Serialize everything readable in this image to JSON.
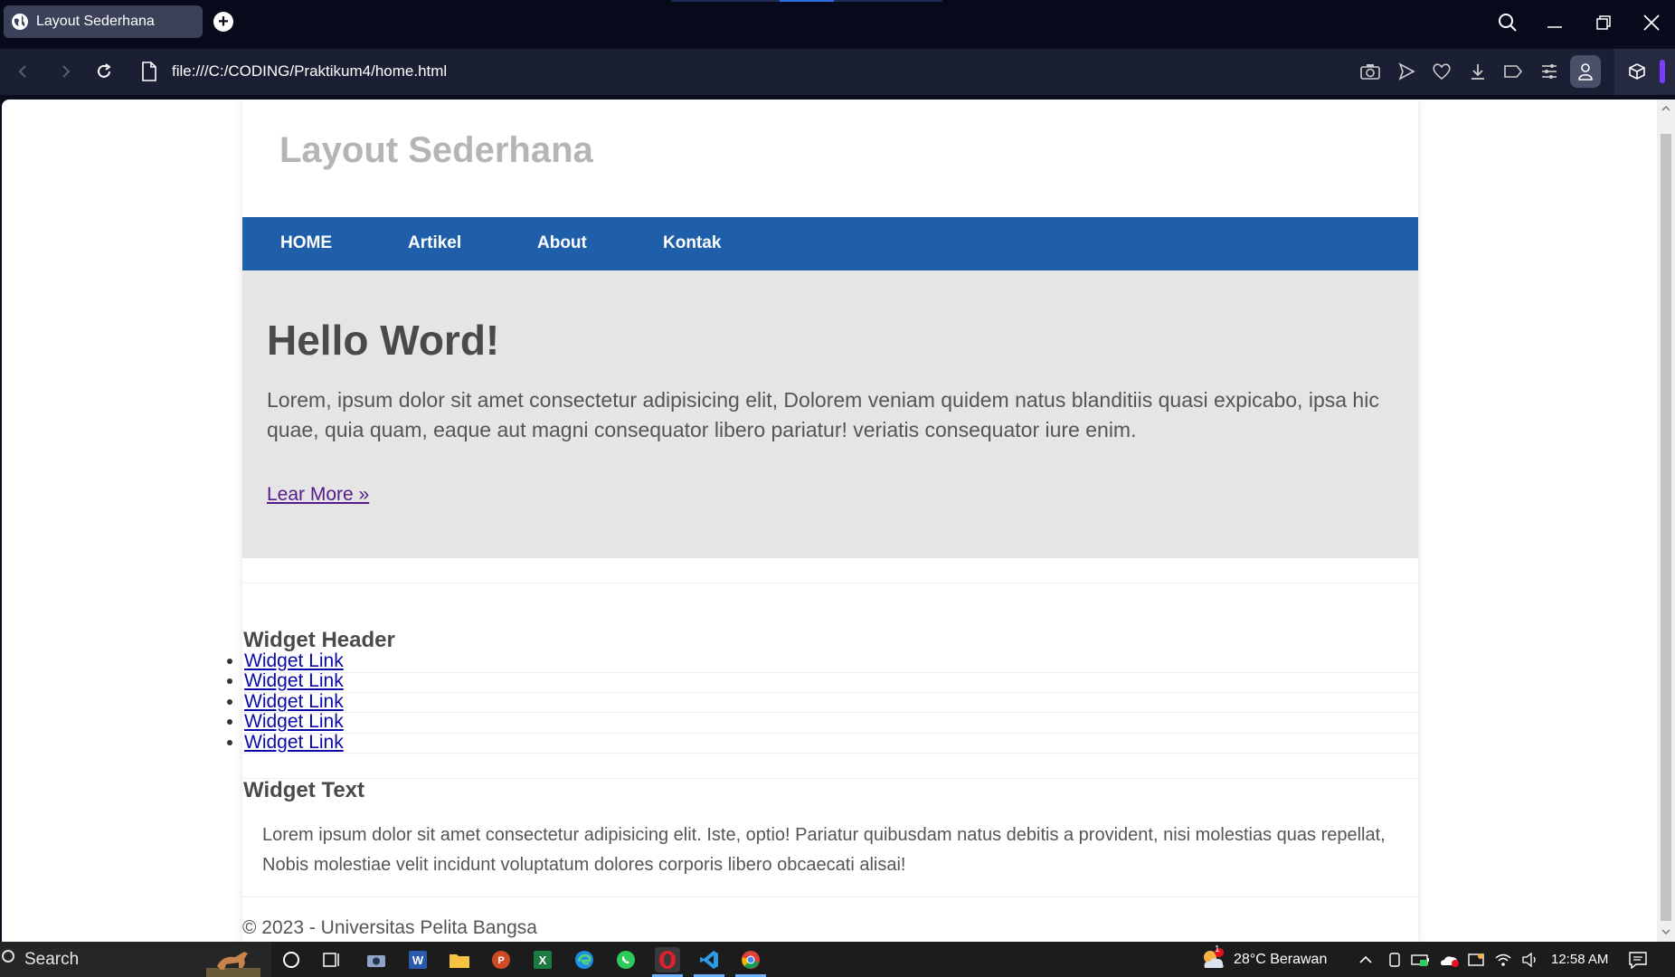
{
  "browser": {
    "tab_title": "Layout Sederhana",
    "new_tab": "+",
    "url": "file:///C:/CODING/Praktikum4/home.html"
  },
  "page": {
    "site_title": "Layout Sederhana",
    "nav": [
      "HOME",
      "Artikel",
      "About",
      "Kontak"
    ],
    "hero": {
      "heading": "Hello Word!",
      "text": "Lorem, ipsum dolor sit amet consectetur adipisicing elit, Dolorem veniam quidem natus blanditiis quasi expicabo, ipsa hic quae, quia quam, eaque aut magni consequator libero pariatur! veriatis consequator iure enim.",
      "link": "Lear More »"
    },
    "widget_header": "Widget Header",
    "widget_links": [
      "Widget Link",
      "Widget Link",
      "Widget Link",
      "Widget Link",
      "Widget Link"
    ],
    "widget_text_header": "Widget Text",
    "widget_text": "Lorem ipsum dolor sit amet consectetur adipisicing elit. Iste, optio! Pariatur quibusdam natus debitis a provident, nisi molestias quas repellat, Nobis molestiae velit incidunt voluptatum dolores corporis libero obcaecati alisai!",
    "footer": "© 2023 - Universitas Pelita Bangsa"
  },
  "taskbar": {
    "search_label": "Search",
    "weather": "28°C  Berawan",
    "weather_badge": "1",
    "time": "12:58 AM"
  },
  "colors": {
    "nav_bg": "#1f5faa",
    "hero_bg": "#e5e5e5",
    "browser_dark": "#070a1a"
  }
}
